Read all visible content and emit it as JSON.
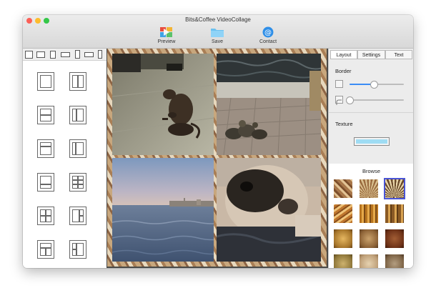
{
  "window": {
    "title": "Bits&Coffee VideoCollage"
  },
  "toolbar": {
    "preview_label": "Preview",
    "save_label": "Save",
    "contact_label": "Contact"
  },
  "tabs": [
    {
      "label": "Layout",
      "active": true
    },
    {
      "label": "Settings",
      "active": false
    },
    {
      "label": "Text",
      "active": false
    }
  ],
  "layout_panel": {
    "border_label": "Border",
    "border_width": 0.45,
    "corner_radius": 0.0,
    "texture_label": "Texture",
    "texture_color": "#9fdcf3",
    "browse_label": "Browse",
    "selected_texture_index": 2
  },
  "colors": {
    "accent": "#3b8cf5",
    "selection": "#4a55d6"
  },
  "collage_cells": [
    "cat-on-floor-video",
    "ducklings-on-bricks-video",
    "seaside-town-video",
    "pug-closeup-video"
  ]
}
